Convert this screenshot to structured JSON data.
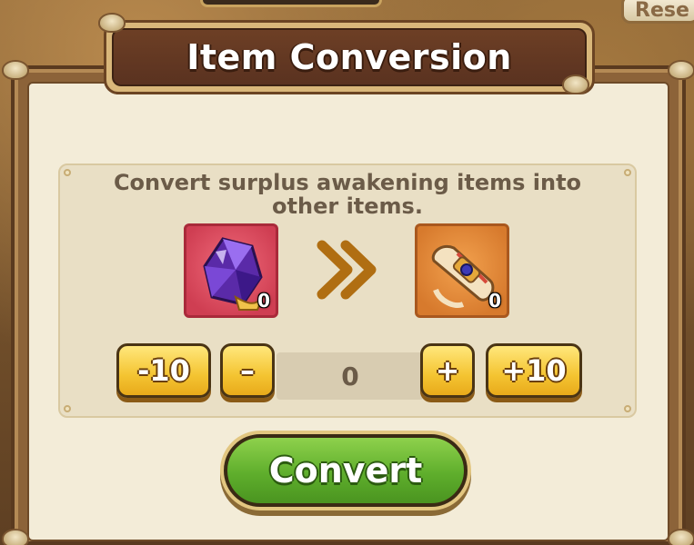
{
  "background": {
    "reset_button_label": "Rese"
  },
  "dialog": {
    "title": "Item Conversion",
    "description": "Convert surplus awakening items into other items.",
    "source_item": {
      "icon": "purple-crystal-icon",
      "count": "0",
      "frame_color": "#cf3e52"
    },
    "arrow_icon": "double-chevron-right-icon",
    "target_item": {
      "icon": "scroll-icon",
      "count": "0",
      "frame_color": "#d77a2d"
    },
    "quantity": {
      "minus_ten_label": "-10",
      "minus_label": "–",
      "value": "0",
      "plus_label": "+",
      "plus_ten_label": "+10"
    },
    "convert_label": "Convert"
  },
  "colors": {
    "accent_yellow": "#f4c431",
    "convert_green": "#5fae2c",
    "title_brown": "#5a3220",
    "panel_bg": "#e9dfc5"
  }
}
